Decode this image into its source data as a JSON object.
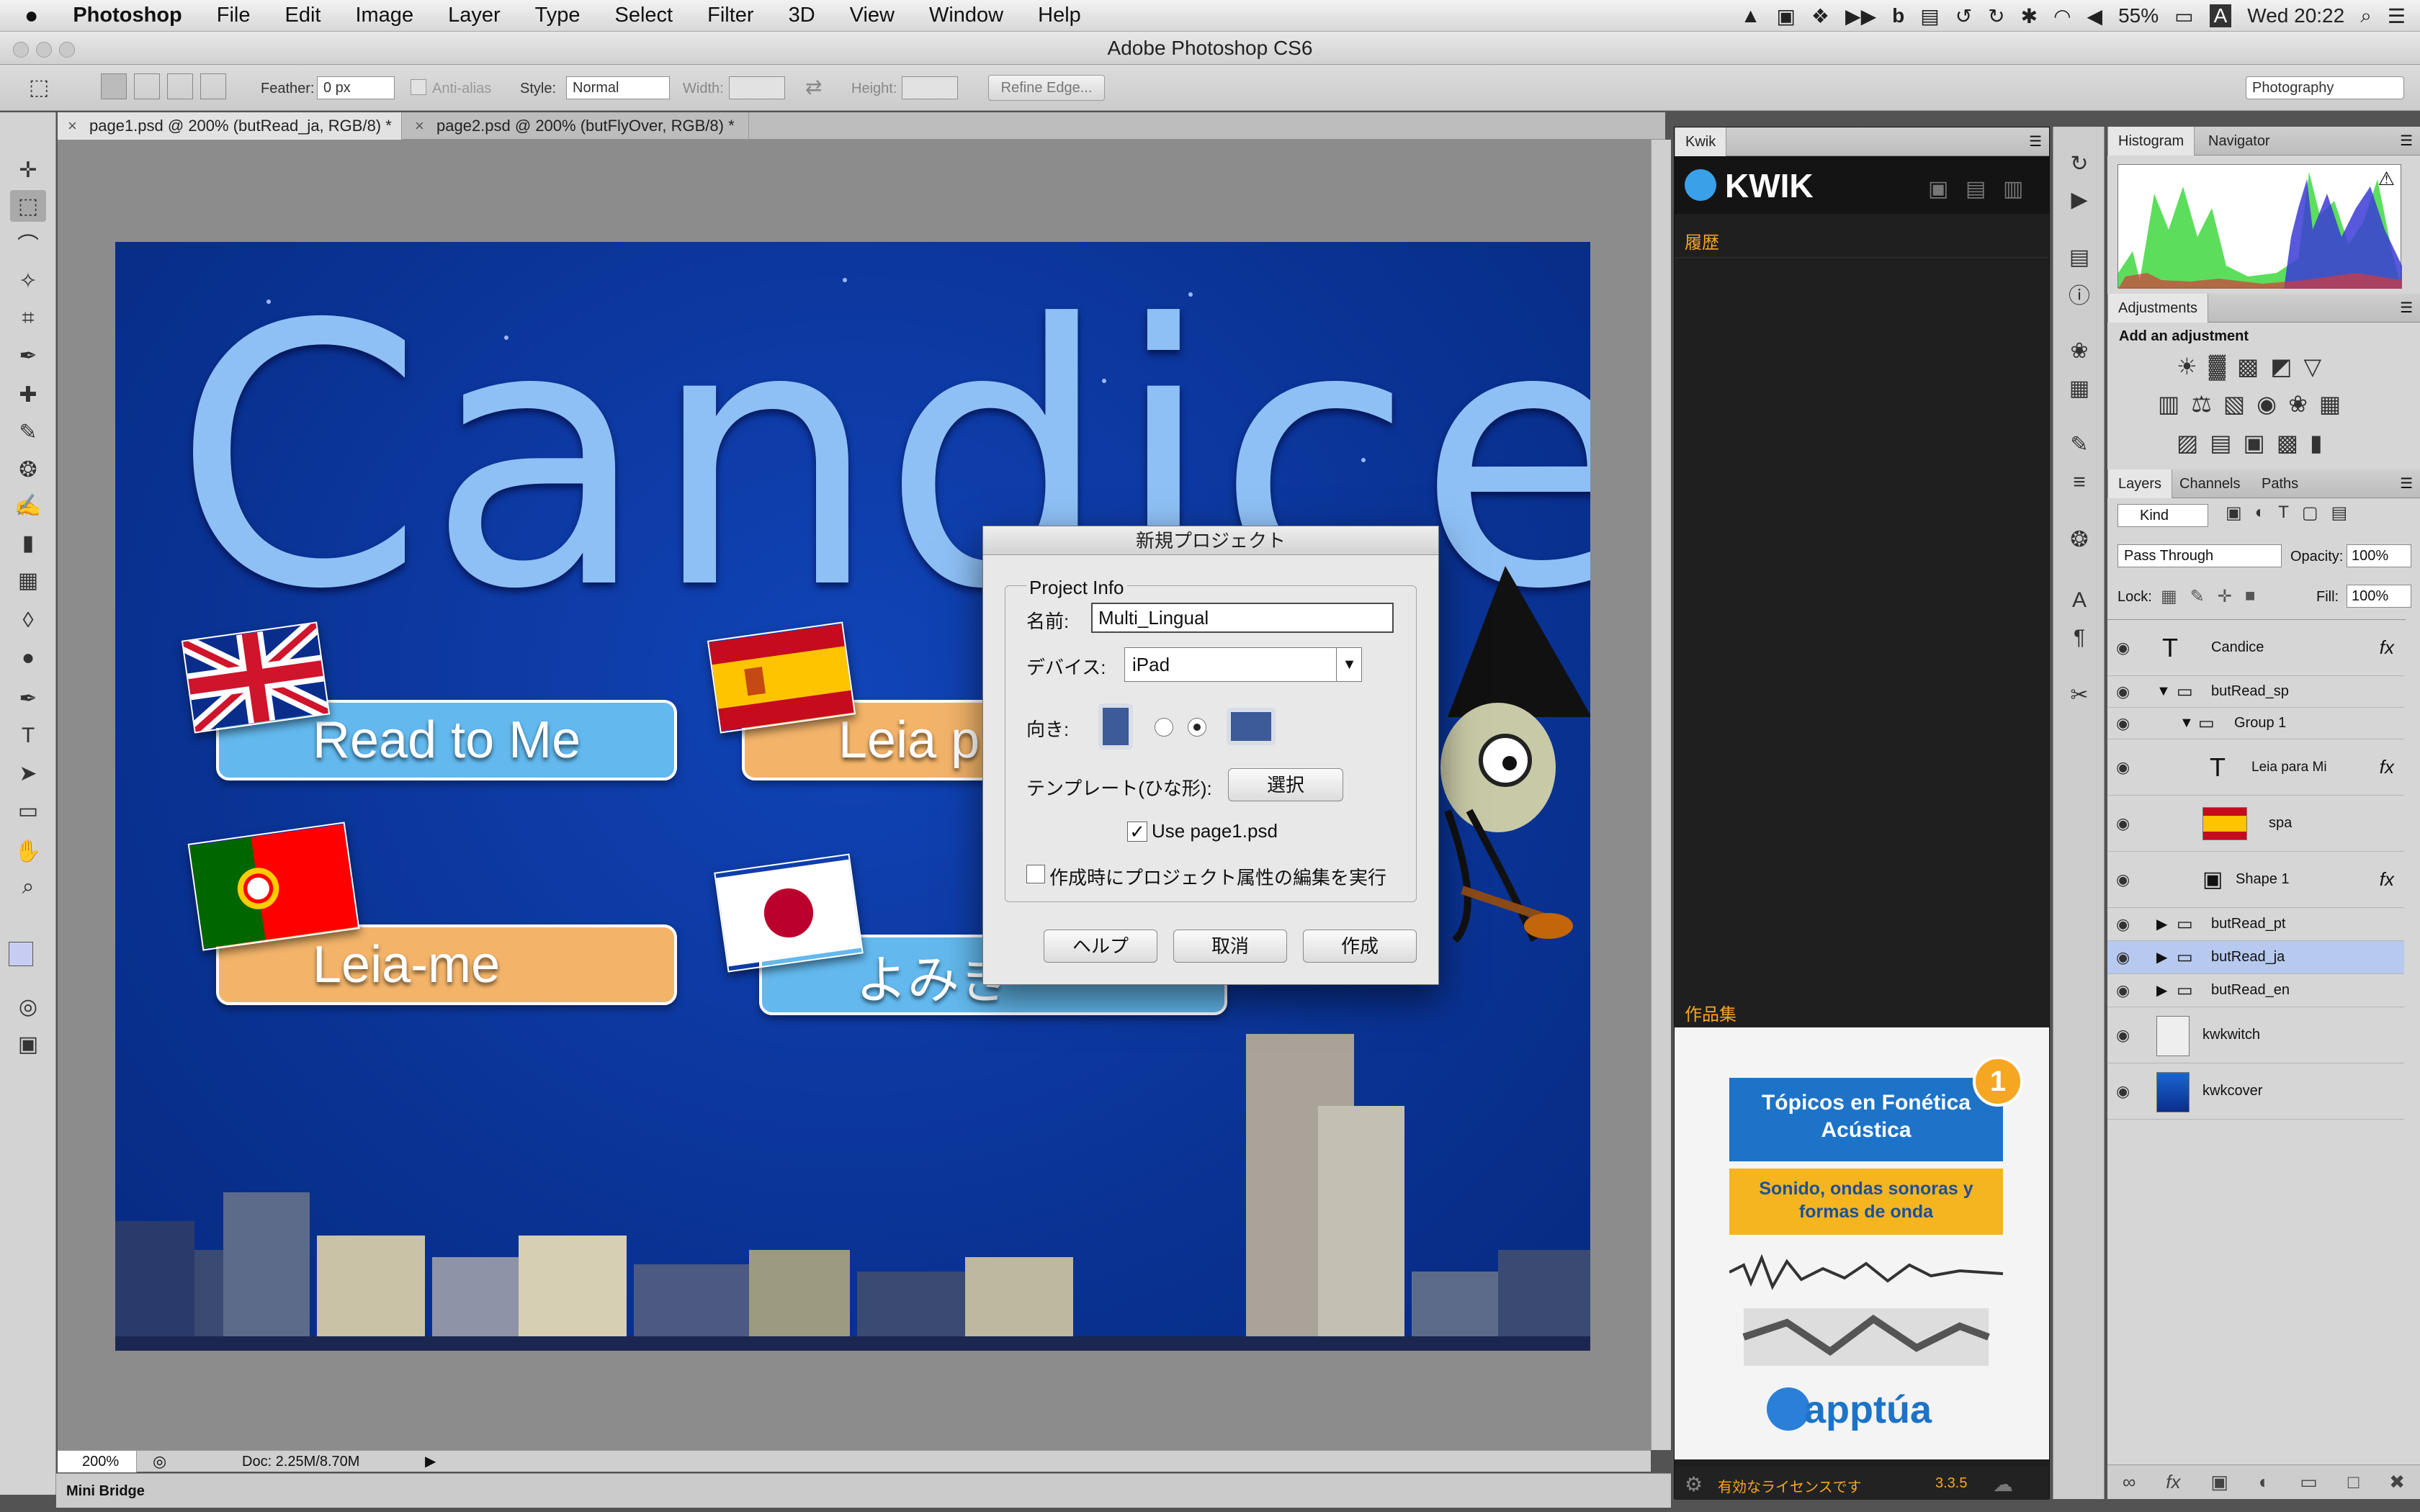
{
  "menubar": {
    "apple": "",
    "app": "Photoshop",
    "items": [
      "File",
      "Edit",
      "Image",
      "Layer",
      "Type",
      "Select",
      "Filter",
      "3D",
      "View",
      "Window",
      "Help"
    ],
    "battery": "55%",
    "input_source": "A",
    "clock": "Wed 20:22"
  },
  "window": {
    "title": "Adobe Photoshop CS6"
  },
  "options": {
    "feather_label": "Feather:",
    "feather_value": "0 px",
    "antialias_label": "Anti-alias",
    "style_label": "Style:",
    "style_value": "Normal",
    "width_label": "Width:",
    "height_label": "Height:",
    "refine_edge": "Refine Edge...",
    "workspace": "Photography"
  },
  "tabs": [
    {
      "label": "page1.psd @ 200% (butRead_ja, RGB/8) *"
    },
    {
      "label": "page2.psd @ 200% (butFlyOver, RGB/8) *"
    }
  ],
  "artwork": {
    "title": "Candice",
    "buttons": [
      "Read to Me",
      "Leia p",
      "Leia-me",
      "よみき"
    ],
    "colors": {
      "sky": "#0a3395",
      "pill_blue": "#63b9ee",
      "pill_orange": "#f3b46a",
      "title": "#8ec0f5"
    }
  },
  "status": {
    "zoom": "200%",
    "doc": "Doc: 2.25M/8.70M"
  },
  "minibridge": "Mini Bridge",
  "kwik": {
    "tab": "Kwik",
    "logo": "KWIK",
    "history": "履歴",
    "portfolio": "作品集",
    "promo_title": "Tópicos en Fonética Acústica",
    "promo_subtitle": "Sonido, ondas sonoras y formas de onda",
    "promo_badge": "1",
    "promo_brand": "apptúa",
    "license": "有効なライセンスです",
    "version": "3.3.5"
  },
  "histogram": {
    "tabs": [
      "Histogram",
      "Navigator"
    ],
    "warning": "⚠"
  },
  "adjustments": {
    "tab": "Adjustments",
    "hint": "Add an adjustment"
  },
  "layers_panel": {
    "tabs": [
      "Layers",
      "Channels",
      "Paths"
    ],
    "kind": "Kind",
    "blend": "Pass Through",
    "opacity_label": "Opacity:",
    "opacity": "100%",
    "lock_label": "Lock:",
    "fill_label": "Fill:",
    "fill": "100%",
    "layers": [
      {
        "name": "Candice",
        "type": "text",
        "fx": true
      },
      {
        "name": "butRead_sp",
        "type": "group"
      },
      {
        "name": "Group 1",
        "type": "group"
      },
      {
        "name": "Leia para Mi",
        "type": "text",
        "fx": true
      },
      {
        "name": "spa",
        "type": "image"
      },
      {
        "name": "Shape 1",
        "type": "shape",
        "fx": true
      },
      {
        "name": "butRead_pt",
        "type": "group"
      },
      {
        "name": "butRead_ja",
        "type": "group",
        "selected": true
      },
      {
        "name": "butRead_en",
        "type": "group"
      },
      {
        "name": "kwkwitch",
        "type": "image"
      },
      {
        "name": "kwkcover",
        "type": "image"
      }
    ]
  },
  "dialog": {
    "title": "新規プロジェクト",
    "group": "Project Info",
    "name_label": "名前:",
    "name_value": "Multi_Lingual",
    "device_label": "デバイス:",
    "device_value": "iPad",
    "orientation_label": "向き:",
    "template_label": "テンプレート(ひな形):",
    "select_button": "選択",
    "use_page": "Use page1.psd",
    "edit_attrs": "作成時にプロジェクト属性の編集を実行",
    "help_button": "ヘルプ",
    "cancel_button": "取消",
    "create_button": "作成"
  }
}
